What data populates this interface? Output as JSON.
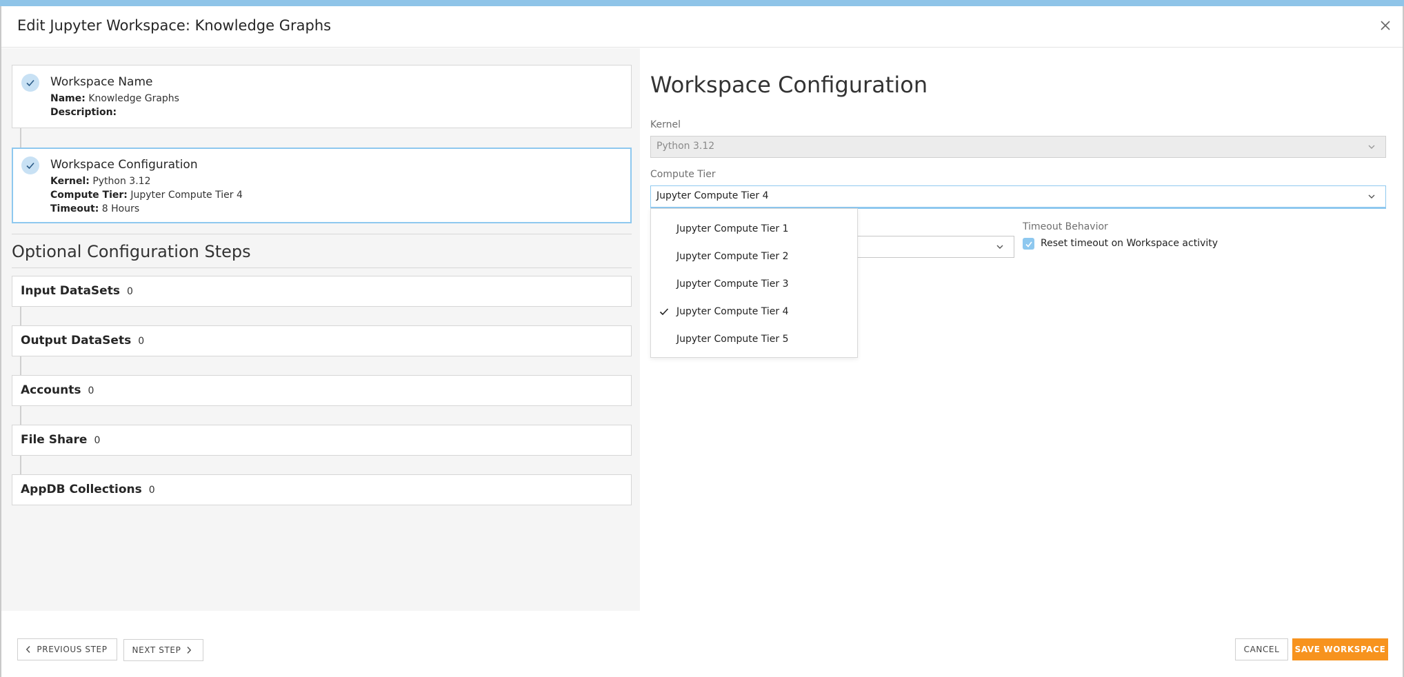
{
  "dialog": {
    "title": "Edit Jupyter Workspace: Knowledge Graphs",
    "close_icon": "close-icon"
  },
  "steps": {
    "workspace_name": {
      "title": "Workspace Name",
      "name_label": "Name:",
      "name_value": "Knowledge Graphs",
      "description_label": "Description:",
      "description_value": ""
    },
    "workspace_configuration": {
      "title": "Workspace Configuration",
      "kernel_label": "Kernel:",
      "kernel_value": "Python 3.12",
      "compute_label": "Compute Tier:",
      "compute_value": "Jupyter Compute Tier 4",
      "timeout_label": "Timeout:",
      "timeout_value": "8 Hours"
    }
  },
  "optional": {
    "heading": "Optional Configuration Steps",
    "items": [
      {
        "label": "Input DataSets",
        "count": "0"
      },
      {
        "label": "Output DataSets",
        "count": "0"
      },
      {
        "label": "Accounts",
        "count": "0"
      },
      {
        "label": "File Share",
        "count": "0"
      },
      {
        "label": "AppDB Collections",
        "count": "0"
      }
    ]
  },
  "config_panel": {
    "title": "Workspace Configuration",
    "kernel_label": "Kernel",
    "kernel_value": "Python 3.12",
    "compute_label": "Compute Tier",
    "compute_value": "Jupyter Compute Tier 4",
    "timeout_behavior_label": "Timeout Behavior",
    "reset_timeout_label": "Reset timeout on Workspace activity",
    "reset_timeout_checked": true
  },
  "compute_dropdown": {
    "options": [
      "Jupyter Compute Tier 1",
      "Jupyter Compute Tier 2",
      "Jupyter Compute Tier 3",
      "Jupyter Compute Tier 4",
      "Jupyter Compute Tier 5"
    ],
    "selected_index": 3
  },
  "footer": {
    "previous_label": "PREVIOUS STEP",
    "next_label": "NEXT STEP",
    "cancel_label": "CANCEL",
    "save_label": "SAVE WORKSPACE"
  },
  "colors": {
    "accent": "#8ec8ef",
    "primary_button": "#f7931e",
    "top_bar": "#8fc4e8"
  }
}
